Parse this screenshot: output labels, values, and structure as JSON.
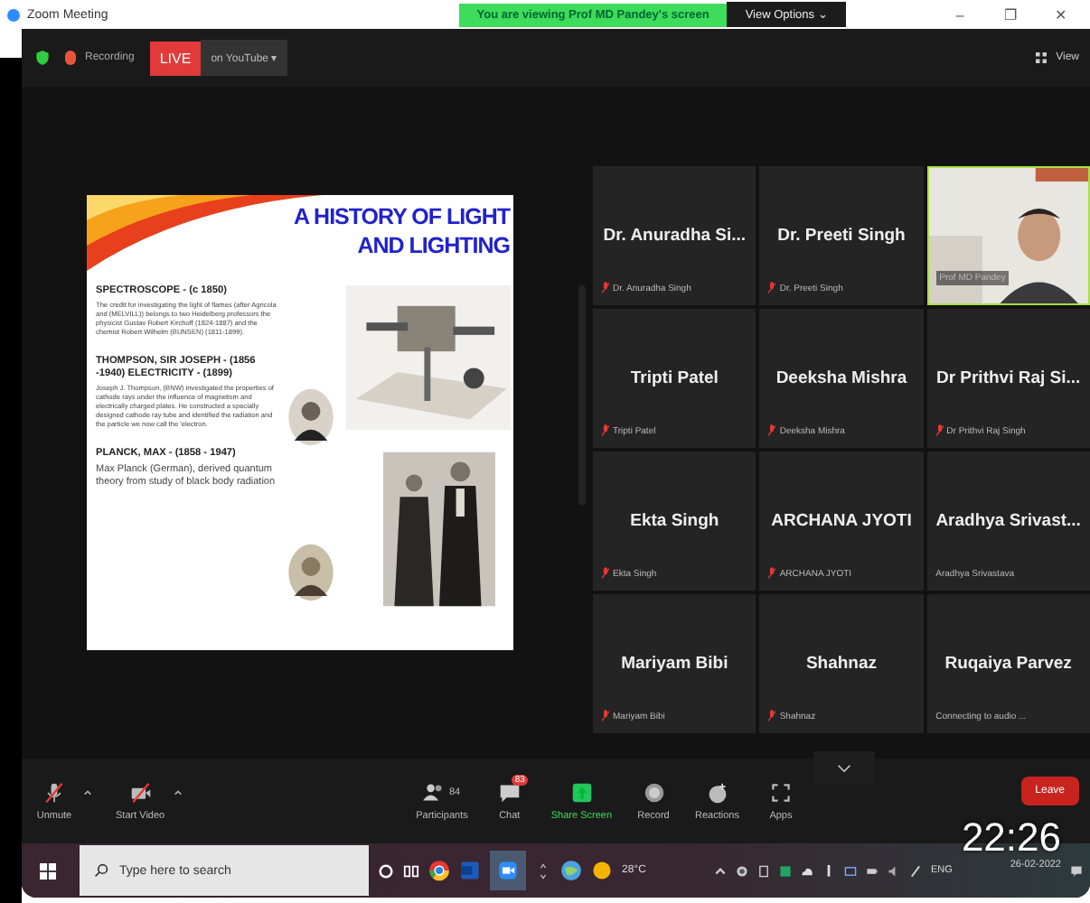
{
  "window": {
    "title": "Zoom Meeting",
    "banner": "You are viewing Prof MD Pandey's screen",
    "view_options": "View Options ⌄",
    "controls": [
      "–",
      "❐",
      "✕"
    ]
  },
  "meeting_bar": {
    "recording": "Recording",
    "live": "LIVE",
    "live_target": "on YouTube ▾",
    "view": "View"
  },
  "slide": {
    "title_lines": [
      "A HISTORY OF LIGHT",
      "AND LIGHTING"
    ],
    "sections": [
      {
        "heading": "SPECTROSCOPE - (c 1850)",
        "body": "The credit for investigating the light of flames (after Agricola and (MELVILL)) belongs to two Heidelberg professors the physicist Gustav Robert Kirchoff (1824-1887) and the chemist Robert Wilhelm (BUNSEN) (1811-1899)."
      },
      {
        "heading": "THOMPSON, SIR JOSEPH - (1856 -1940) ELECTRICITY - (1899)",
        "body": "Joseph J. Thompson, (BNW) investigated the properties of cathode rays under the influence of magnetism and electrically charged plates. He constructed a specially designed cathode ray tube and identified the radiation and the particle we now call the 'electron."
      },
      {
        "heading": "PLANCK, MAX - (1858 - 1947)",
        "body": "Max Planck (German), derived quantum theory from study of black body radiation"
      }
    ]
  },
  "participants": [
    {
      "kind": "avatar",
      "name": "Dr. Anuradha Si...",
      "label": "Dr. Anuradha Singh",
      "muted": true,
      "speaking": false
    },
    {
      "kind": "avatar",
      "name": "Dr. Preeti Singh",
      "label": "Dr. Preeti Singh",
      "muted": true,
      "speaking": false
    },
    {
      "kind": "video",
      "label": "Prof MD Pandey",
      "muted": false,
      "speaking": true
    },
    {
      "kind": "avatar",
      "name": "Tripti Patel",
      "label": "Tripti Patel",
      "muted": true,
      "speaking": false
    },
    {
      "kind": "avatar",
      "name": "Deeksha Mishra",
      "label": "Deeksha Mishra",
      "muted": true,
      "speaking": false
    },
    {
      "kind": "avatar",
      "name": "Dr Prithvi Raj Si...",
      "label": "Dr Prithvi Raj Singh",
      "muted": true,
      "speaking": false
    },
    {
      "kind": "avatar",
      "name": "Ekta Singh",
      "label": "Ekta Singh",
      "muted": true,
      "speaking": false
    },
    {
      "kind": "avatar",
      "name": "ARCHANA JYOTI",
      "label": "ARCHANA JYOTI",
      "muted": true,
      "speaking": false
    },
    {
      "kind": "avatar",
      "name": "Aradhya  Srivast...",
      "label": "Aradhya Srivastava",
      "muted": false,
      "speaking": false
    },
    {
      "kind": "avatar",
      "name": "Mariyam Bibi",
      "label": "Mariyam Bibi",
      "muted": true,
      "speaking": false
    },
    {
      "kind": "avatar",
      "name": "Shahnaz",
      "label": "Shahnaz",
      "muted": true,
      "speaking": false
    },
    {
      "kind": "avatar",
      "name": "Ruqaiya Parvez",
      "label": "Connecting to audio ...",
      "muted": false,
      "speaking": false
    }
  ],
  "toolbar": {
    "left": [
      {
        "kind": "mic",
        "label": "Unmute"
      },
      {
        "kind": "video",
        "label": "Start Video"
      }
    ],
    "center": [
      {
        "kind": "participants",
        "label": "Participants",
        "count": "84"
      },
      {
        "kind": "chat",
        "label": "Chat",
        "badge": "83"
      },
      {
        "kind": "share",
        "label": "Share Screen"
      },
      {
        "kind": "record",
        "label": "Record"
      },
      {
        "kind": "reactions",
        "label": "Reactions"
      },
      {
        "kind": "apps",
        "label": "Apps"
      }
    ],
    "leave": "Leave"
  },
  "taskbar": {
    "search_placeholder": "Type here to search",
    "temperature": "28°C",
    "language": "ENG",
    "time": "22:26",
    "date": "26-02-2022"
  }
}
